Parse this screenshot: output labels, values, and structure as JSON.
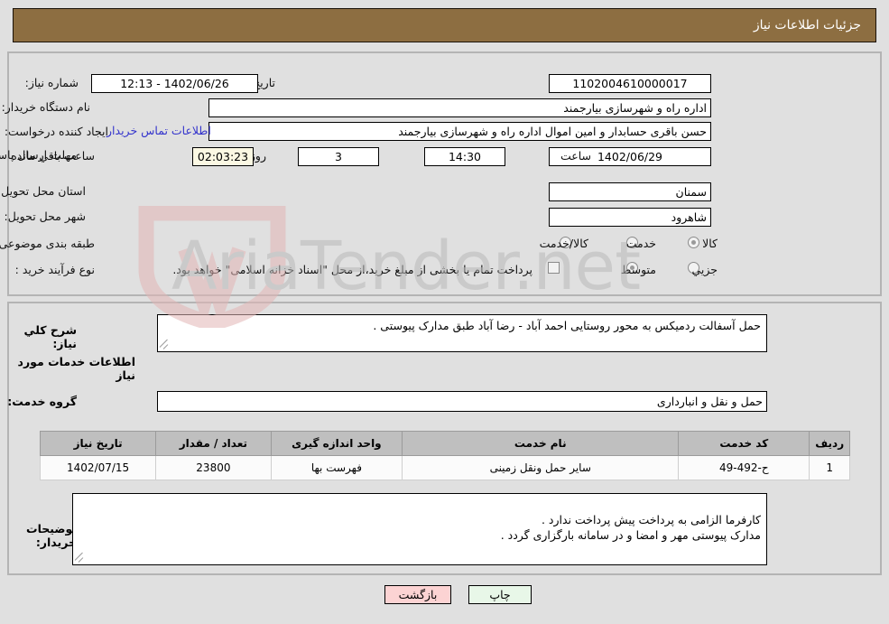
{
  "header": {
    "title": "جزئیات اطلاعات نیاز"
  },
  "form": {
    "need_number_label": "شماره نیاز:",
    "need_number_value": "1102004610000017",
    "public_announce_label": "تاریخ و ساعت اعلان عمومی:",
    "public_announce_value": "1402/06/26 - 12:13",
    "buyer_org_label": "نام دستگاه خریدار:",
    "buyer_org_value": "اداره راه و شهرسازی بیارجمند",
    "creator_label": "ایجاد کننده درخواست:",
    "creator_value": "حسن باقری حسابدار و امین اموال  اداره راه و شهرسازی بیارجمند",
    "contact_link": "اطلاعات تماس خریدار",
    "deadline_label": "مهلت ارسال پاسخ: تا تاریخ:",
    "deadline_date": "1402/06/29",
    "time_label": "ساعت",
    "time_value": "14:30",
    "days_value": "3",
    "days_label": "روز و",
    "countdown_value": "02:03:23",
    "remaining_label": "ساعت باقي مانده",
    "province_label": "استان محل تحویل:",
    "province_value": "سمنان",
    "city_label": "شهر محل تحویل:",
    "city_value": "شاهرود",
    "category_label": "طبقه بندی موضوعی:",
    "category_options": [
      {
        "label": "کالا",
        "selected": false
      },
      {
        "label": "خدمت",
        "selected": true
      },
      {
        "label": "کالا/خدمت",
        "selected": false
      }
    ],
    "process_label": "نوع فرآیند خرید :",
    "process_options": [
      {
        "label": "جزیي",
        "selected": false
      },
      {
        "label": "متوسط",
        "selected": true
      }
    ],
    "treasury_checkbox_label": "پرداخت تمام یا بخشی از مبلغ خرید،از محل \"اسناد خزانه اسلامی\" خواهد بود.",
    "treasury_checked": false
  },
  "middle": {
    "general_desc_label": "شرح کلي نیاز:",
    "general_desc_value": "حمل آسفالت ردمیکس به محور روستایی احمد آباد - رضا آباد طبق مدارک پیوستی .",
    "services_info_title": "اطلاعات خدمات مورد نیاز",
    "service_group_label": "گروه خدمت:",
    "service_group_value": "حمل و نقل و انبارداری",
    "buyer_notes_label": "توضیحات خریدار:",
    "buyer_notes_value": "کارفرما الزامی به پرداخت پیش پرداخت ندارد .\nمدارک پیوستی مهر و امضا و در سامانه بارگزاری گردد ."
  },
  "table": {
    "headers": [
      "ردیف",
      "کد خدمت",
      "نام خدمت",
      "واحد اندازه گیری",
      "تعداد / مقدار",
      "تاریخ نیاز"
    ],
    "rows": [
      {
        "row": "1",
        "code": "ح-492-49",
        "name": "سایر حمل ونقل زمینی",
        "unit": "فهرست بها",
        "qty": "23800",
        "date": "1402/07/15"
      }
    ]
  },
  "buttons": {
    "print": "چاپ",
    "back": "بازگشت"
  },
  "watermark": {
    "text": "AriaTender.net",
    "shield_color": "#e6b8b8",
    "text_color": "#b9b9b9"
  },
  "colors": {
    "header_bg": "#8d6e41",
    "page_bg": "#e0e0e0",
    "link": "#3333cc",
    "countdown_bg": "#fbf8e3",
    "print_bg": "#e8f7e8",
    "back_bg": "#fcd3d3"
  }
}
